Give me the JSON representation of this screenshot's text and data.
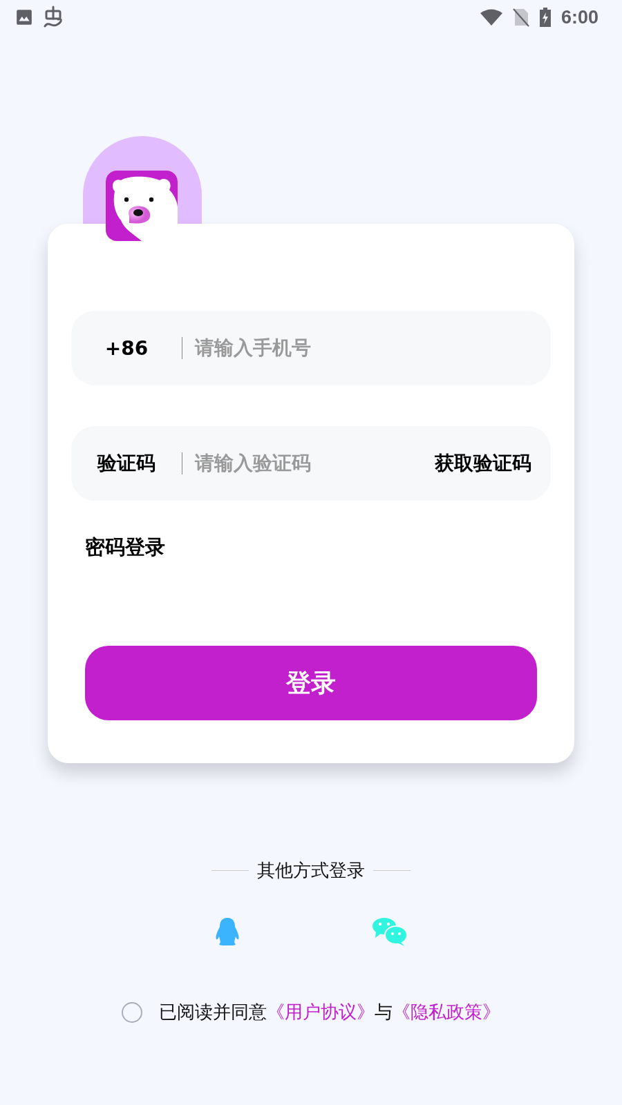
{
  "status_bar": {
    "time": "6:00"
  },
  "phone_field": {
    "prefix": "+86",
    "placeholder": "请输入手机号"
  },
  "code_field": {
    "label": "验证码",
    "placeholder": "请输入验证码",
    "action": "获取验证码"
  },
  "password_login_link": "密码登录",
  "login_button": "登录",
  "other_login": {
    "title": "其他方式登录"
  },
  "agreement": {
    "checked": false,
    "text": "已阅读并同意",
    "user_agreement": "《用户协议》",
    "conjunction": "与",
    "privacy_policy": "《隐私政策》"
  }
}
